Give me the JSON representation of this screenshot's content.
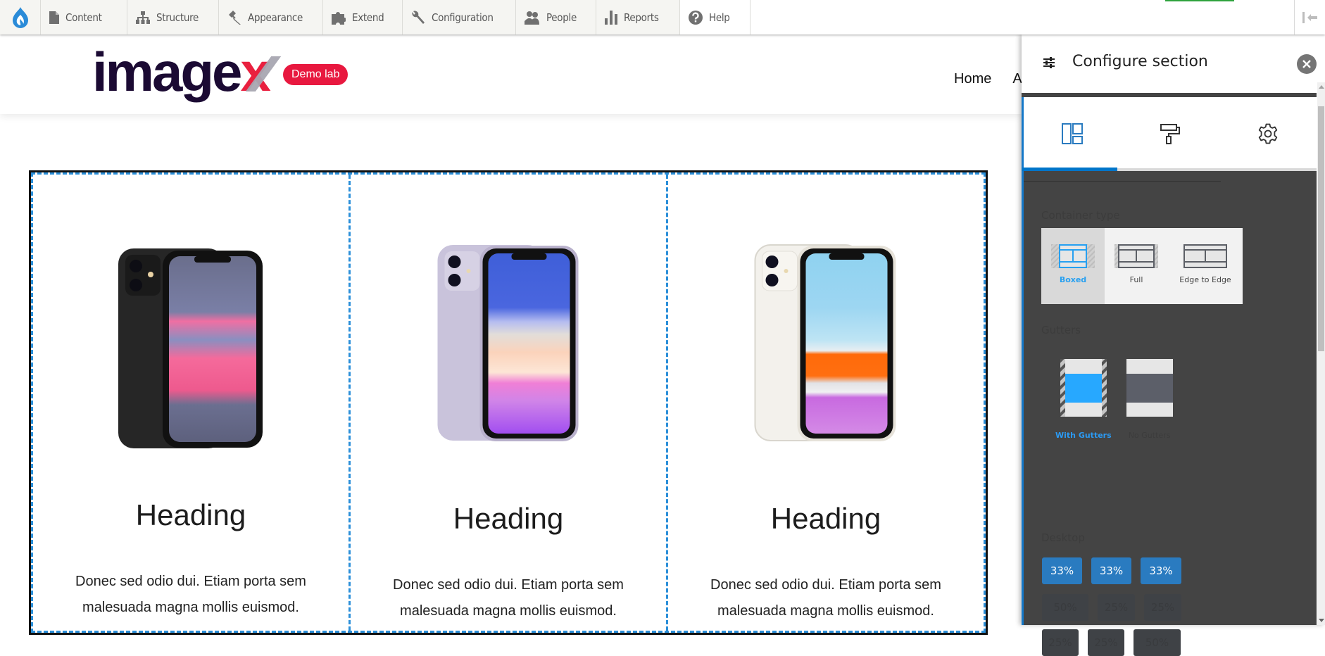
{
  "toolbar": {
    "items": [
      {
        "label": "Content",
        "icon": "file-icon"
      },
      {
        "label": "Structure",
        "icon": "sitemap-icon"
      },
      {
        "label": "Appearance",
        "icon": "paintbrush-icon"
      },
      {
        "label": "Extend",
        "icon": "puzzle-icon"
      },
      {
        "label": "Configuration",
        "icon": "wrench-icon"
      },
      {
        "label": "People",
        "icon": "people-icon"
      },
      {
        "label": "Reports",
        "icon": "bar-chart-icon"
      },
      {
        "label": "Help",
        "icon": "help-icon"
      }
    ]
  },
  "site": {
    "logo_main": "image",
    "logo_x": "x",
    "badge": "Demo lab",
    "nav": [
      "Home",
      "A"
    ]
  },
  "section": {
    "columns": [
      {
        "phone": "black",
        "heading": "Heading",
        "text": "Donec sed odio dui. Etiam porta sem malesuada magna mollis euismod."
      },
      {
        "phone": "purple",
        "heading": "Heading",
        "text": "Donec sed odio dui. Etiam porta sem malesuada magna mollis euismod."
      },
      {
        "phone": "white",
        "heading": "Heading",
        "text": "Donec sed odio dui. Etiam porta sem malesuada magna mollis euismod."
      }
    ]
  },
  "panel": {
    "title": "Configure section",
    "tabs": [
      {
        "name": "layout",
        "icon": "layout-icon",
        "active": true
      },
      {
        "name": "style",
        "icon": "paint-roller-icon",
        "active": false
      },
      {
        "name": "settings",
        "icon": "gear-icon",
        "active": false
      }
    ],
    "container_type": {
      "label": "Container type",
      "options": [
        "Boxed",
        "Full",
        "Edge to Edge"
      ],
      "selected": "Boxed"
    },
    "gutters": {
      "label": "Gutters",
      "options": [
        "With Gutters",
        "No Gutters"
      ],
      "selected": "With Gutters"
    },
    "desktop": {
      "label": "Desktop",
      "rows": [
        {
          "cells": [
            "33%",
            "33%",
            "33%"
          ],
          "selected": true
        },
        {
          "cells": [
            "50%",
            "25%",
            "25%"
          ],
          "selected": false
        },
        {
          "cells": [
            "25%",
            "25%",
            "50%"
          ],
          "selected": false
        }
      ]
    }
  },
  "colors": {
    "accent": "#0075c9",
    "selected_option": "#27a0f0",
    "layout_button": "#2a7bc0",
    "badge": "#e8183f",
    "panel_body": "#444444"
  }
}
